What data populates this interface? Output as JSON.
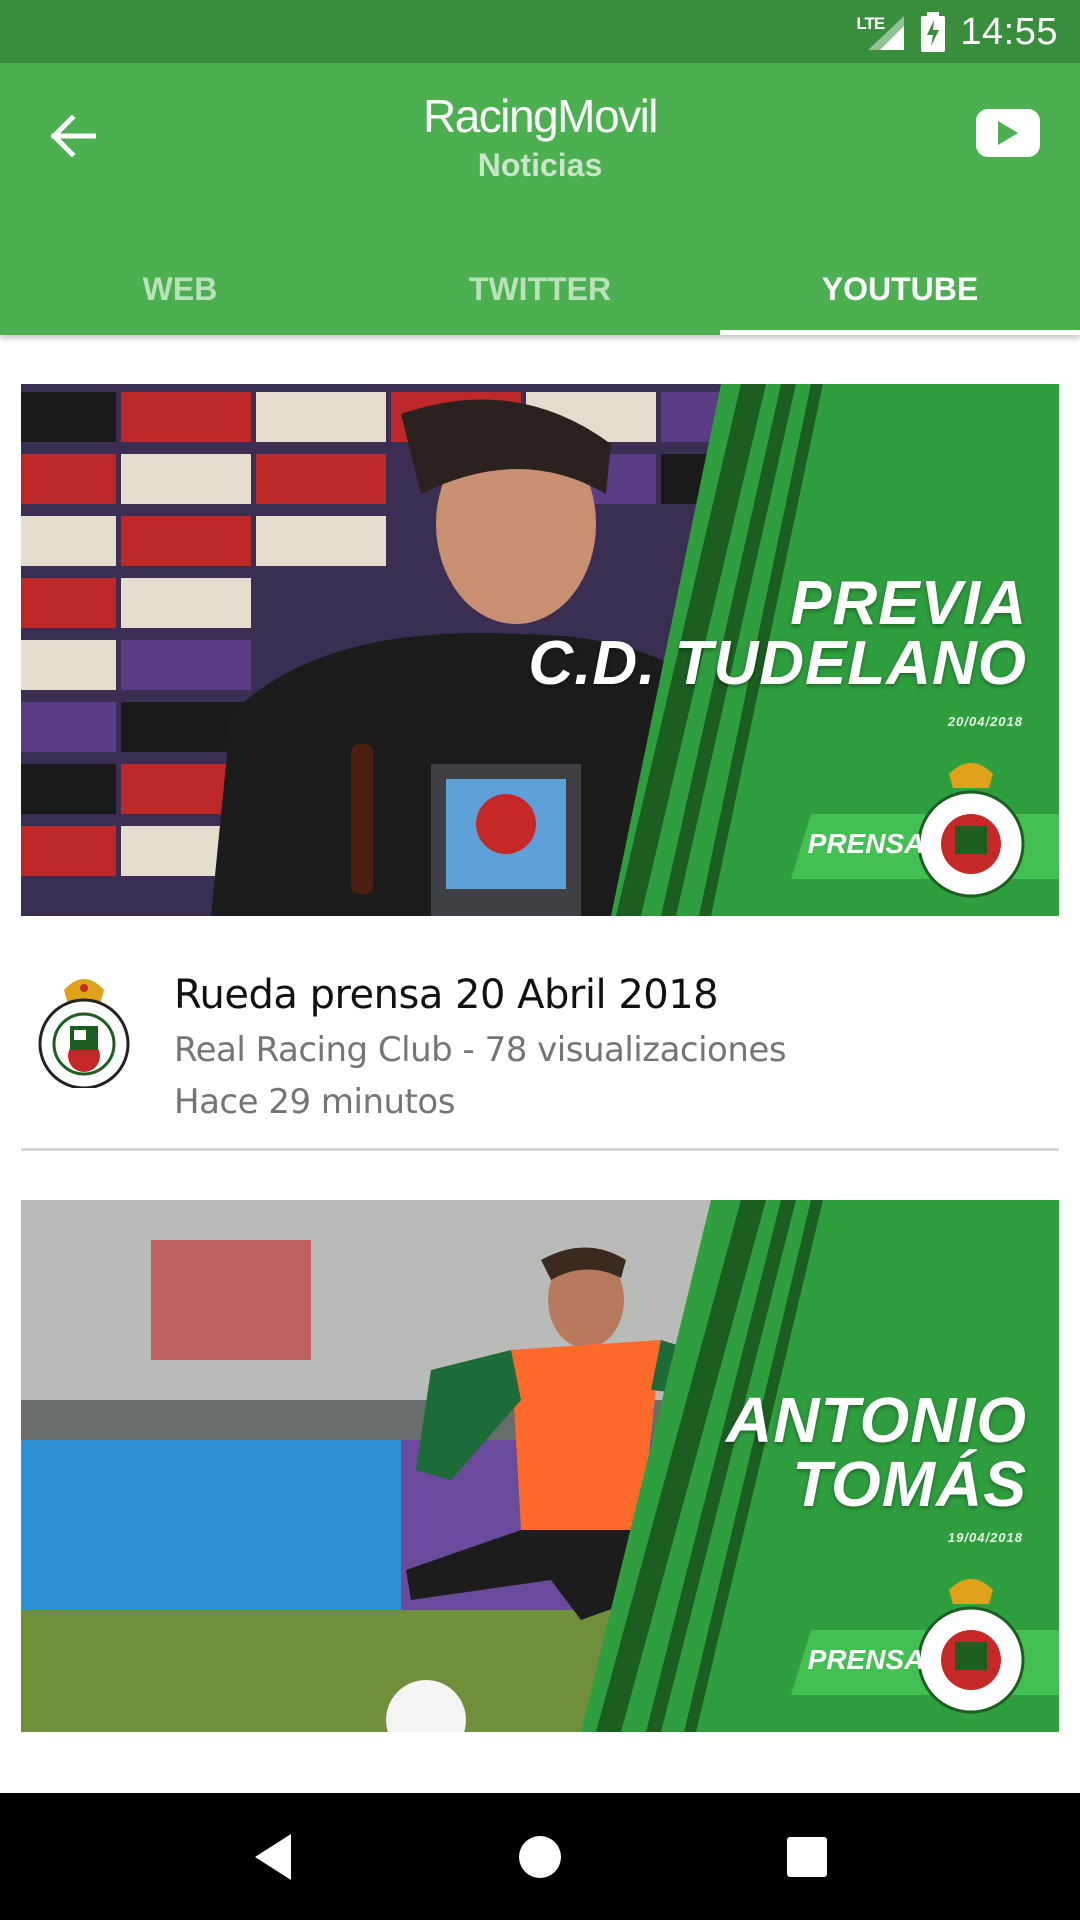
{
  "status_bar": {
    "network": "LTE",
    "time": "14:55",
    "battery_icon": "battery-charging-icon",
    "signal_icon": "signal-icon"
  },
  "app_bar": {
    "title_part1": "Racing",
    "title_part2": "Movil",
    "subtitle": "Noticias",
    "back_icon": "arrow-back-icon",
    "youtube_icon": "youtube-icon"
  },
  "tabs": [
    {
      "label": "WEB",
      "active": false
    },
    {
      "label": "TWITTER",
      "active": false
    },
    {
      "label": "YOUTUBE",
      "active": true
    }
  ],
  "videos": [
    {
      "thumb_title_line1": "PREVIA",
      "thumb_title_line2": "C.D. TUDELANO",
      "thumb_date": "20/04/2018",
      "thumb_badge": "PRENSA",
      "title": "Rueda prensa 20 Abril 2018",
      "channel_views": "Real Racing Club - 78 visualizaciones",
      "time_ago": "Hace 29 minutos"
    },
    {
      "thumb_title_line1": "ANTONIO",
      "thumb_title_line2": "TOMÁS",
      "thumb_date": "19/04/2018",
      "thumb_badge": "PRENSA"
    }
  ],
  "colors": {
    "status_bar": "#388e3c",
    "app_bar": "#4caf50",
    "accent_green": "#2e9e3e"
  },
  "nav": {
    "back": "nav-back-icon",
    "home": "nav-home-icon",
    "recents": "nav-recents-icon"
  }
}
